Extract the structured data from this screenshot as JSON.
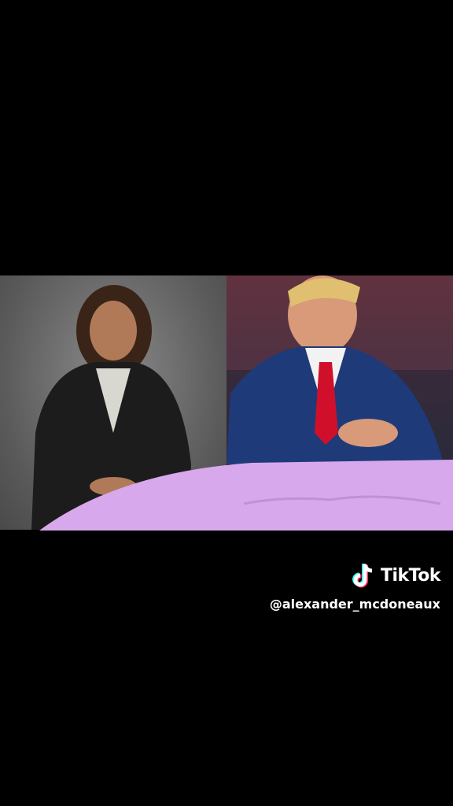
{
  "watermark": {
    "brand": "TikTok",
    "username": "@alexander_mcdoneaux",
    "icon": "tiktok-logo-icon"
  },
  "colors": {
    "background": "#000000",
    "overlay": "#d8a8ec",
    "tie": "#d0102a",
    "suit_right": "#1f3a78",
    "suit_left": "#1a1a1a"
  }
}
